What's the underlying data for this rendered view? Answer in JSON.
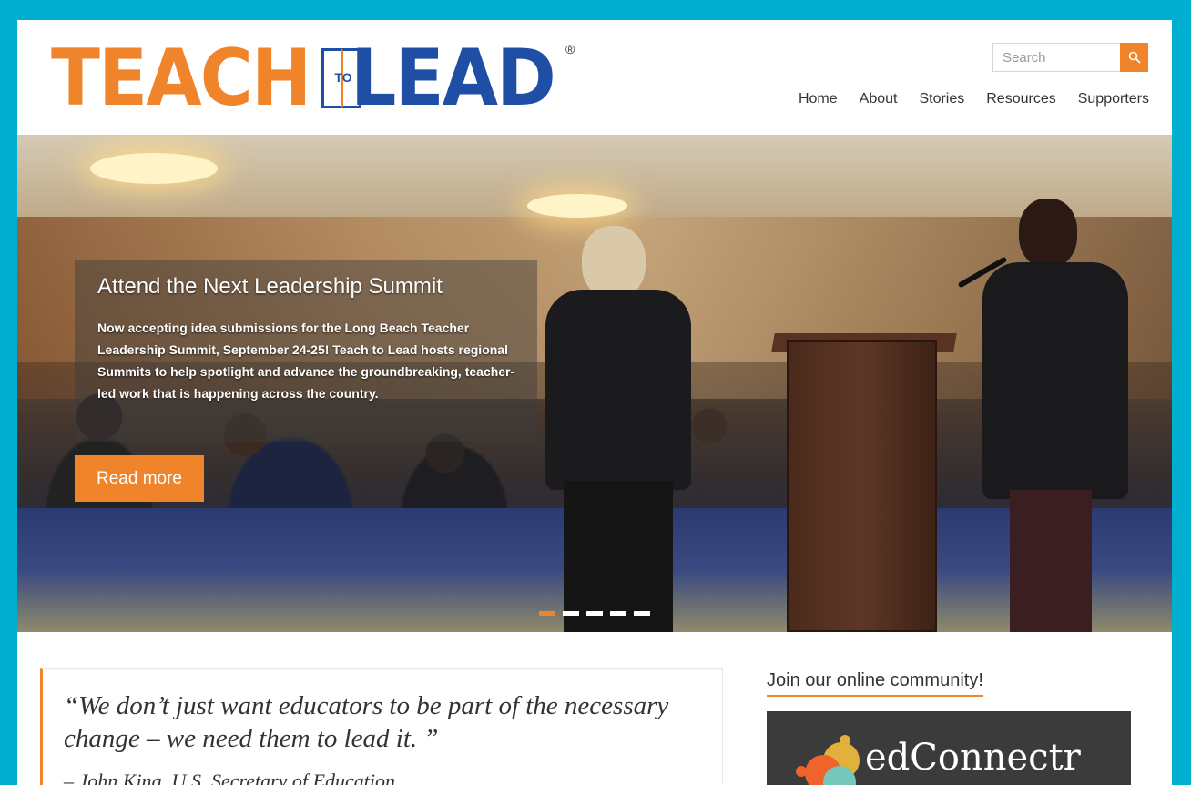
{
  "header": {
    "logo": {
      "teach": "TEACH",
      "to": "TO",
      "lead": "LEAD",
      "registered": "®"
    },
    "search": {
      "placeholder": "Search"
    },
    "nav": [
      {
        "label": "Home"
      },
      {
        "label": "About"
      },
      {
        "label": "Stories"
      },
      {
        "label": "Resources"
      },
      {
        "label": "Supporters"
      }
    ]
  },
  "hero": {
    "title": "Attend the Next Leadership Summit",
    "text": "Now accepting idea submissions for the Long Beach Teacher Leadership Summit, September 24-25! Teach to Lead hosts regional Summits to help spotlight and advance the groundbreaking, teacher-led work that is happening across the country.",
    "button": "Read more",
    "slides": {
      "count": 5,
      "active_index": 0
    }
  },
  "quote": {
    "text": "“We don’t just want educators to be part of the necessary change – we need them to lead it. ”",
    "attribution": "– John King, U.S. Secretary of Education"
  },
  "sidebar": {
    "community_title": "Join our online community!",
    "edconnectr_label": "edConnectr"
  },
  "colors": {
    "frame": "#00aed0",
    "accent_orange": "#f0842a",
    "brand_blue": "#1f4fa4",
    "text": "#333333"
  },
  "icons": {
    "search_button": "search-icon"
  }
}
